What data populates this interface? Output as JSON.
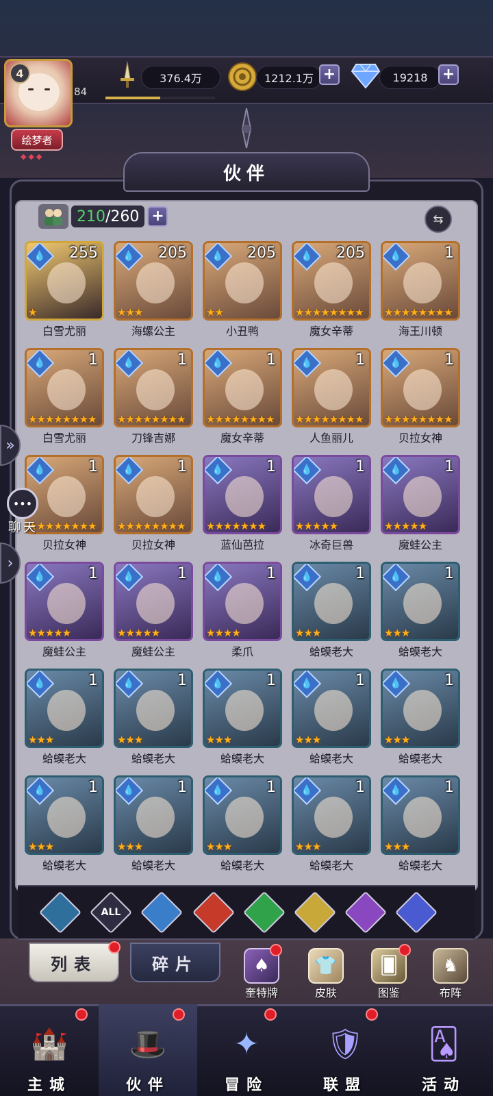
{
  "player": {
    "level": "4",
    "sub_level": "84",
    "title": "绘梦者",
    "title_dots": "◆◆◆",
    "power_progress": 0.5
  },
  "resources": {
    "power": "376.4万",
    "gold": "1212.1万",
    "gems": "19218",
    "plus": "+"
  },
  "panel": {
    "title": "伙伴",
    "count_current": "210",
    "count_max": "/260",
    "plus": "+"
  },
  "partners": [
    {
      "name": "白雪尤丽",
      "level": "255",
      "stars": "★",
      "border": "gold"
    },
    {
      "name": "海螺公主",
      "level": "205",
      "stars": "★★★",
      "border": "orange"
    },
    {
      "name": "小丑鸭",
      "level": "205",
      "stars": "★★",
      "border": "orange"
    },
    {
      "name": "魔女辛蒂",
      "level": "205",
      "stars": "★★★★★★★★",
      "border": "orange"
    },
    {
      "name": "海王川顿",
      "level": "1",
      "stars": "★★★★★★★★",
      "border": "orange"
    },
    {
      "name": "白雪尤丽",
      "level": "1",
      "stars": "★★★★★★★★",
      "border": "orange"
    },
    {
      "name": "刀锋吉娜",
      "level": "1",
      "stars": "★★★★★★★★",
      "border": "orange"
    },
    {
      "name": "魔女辛蒂",
      "level": "1",
      "stars": "★★★★★★★★",
      "border": "orange"
    },
    {
      "name": "人鱼丽儿",
      "level": "1",
      "stars": "★★★★★★★★",
      "border": "orange"
    },
    {
      "name": "贝拉女神",
      "level": "1",
      "stars": "★★★★★★★★",
      "border": "orange"
    },
    {
      "name": "贝拉女神",
      "level": "1",
      "stars": "★★★★★★★★",
      "border": "orange"
    },
    {
      "name": "贝拉女神",
      "level": "1",
      "stars": "★★★★★★★★",
      "border": "orange"
    },
    {
      "name": "蓝仙芭拉",
      "level": "1",
      "stars": "★★★★★★★",
      "border": "purple"
    },
    {
      "name": "冰奇巨兽",
      "level": "1",
      "stars": "★★★★★",
      "border": "purple"
    },
    {
      "name": "魔蛙公主",
      "level": "1",
      "stars": "★★★★★",
      "border": "purple"
    },
    {
      "name": "魔蛙公主",
      "level": "1",
      "stars": "★★★★★",
      "border": "purple"
    },
    {
      "name": "魔蛙公主",
      "level": "1",
      "stars": "★★★★★",
      "border": "purple"
    },
    {
      "name": "柔爪",
      "level": "1",
      "stars": "★★★★",
      "border": "purple"
    },
    {
      "name": "蛤蟆老大",
      "level": "1",
      "stars": "★★★",
      "border": "teal"
    },
    {
      "name": "蛤蟆老大",
      "level": "1",
      "stars": "★★★",
      "border": "teal"
    },
    {
      "name": "蛤蟆老大",
      "level": "1",
      "stars": "★★★",
      "border": "teal"
    },
    {
      "name": "蛤蟆老大",
      "level": "1",
      "stars": "★★★",
      "border": "teal"
    },
    {
      "name": "蛤蟆老大",
      "level": "1",
      "stars": "★★★",
      "border": "teal"
    },
    {
      "name": "蛤蟆老大",
      "level": "1",
      "stars": "★★★",
      "border": "teal"
    },
    {
      "name": "蛤蟆老大",
      "level": "1",
      "stars": "★★★",
      "border": "teal"
    },
    {
      "name": "蛤蟆老大",
      "level": "1",
      "stars": "★★★",
      "border": "teal"
    },
    {
      "name": "蛤蟆老大",
      "level": "1",
      "stars": "★★★",
      "border": "teal"
    },
    {
      "name": "蛤蟆老大",
      "level": "1",
      "stars": "★★★",
      "border": "teal"
    },
    {
      "name": "蛤蟆老大",
      "level": "1",
      "stars": "★★★",
      "border": "teal"
    },
    {
      "name": "蛤蟆老大",
      "level": "1",
      "stars": "★★★",
      "border": "teal"
    }
  ],
  "filters": [
    {
      "name": "filter-water-alt",
      "label": "",
      "color": "#2f6f9c"
    },
    {
      "name": "filter-all",
      "label": "ALL",
      "color": "#2e2c40"
    },
    {
      "name": "filter-water",
      "label": "",
      "color": "#3a7dc8"
    },
    {
      "name": "filter-fire",
      "label": "",
      "color": "#c63a2a"
    },
    {
      "name": "filter-wind",
      "label": "",
      "color": "#2fa24a"
    },
    {
      "name": "filter-light",
      "label": "",
      "color": "#c9a83a"
    },
    {
      "name": "filter-dark",
      "label": "",
      "color": "#8a48c0"
    },
    {
      "name": "filter-cosmic",
      "label": "",
      "color": "#4a5ad0"
    }
  ],
  "tabs": {
    "list": "列表",
    "fragments": "碎片"
  },
  "quick": {
    "tarot": "奎特牌",
    "skin": "皮肤",
    "codex": "图鉴",
    "formation": "布阵"
  },
  "nav": {
    "city": "主城",
    "partner": "伙伴",
    "adventure": "冒险",
    "alliance": "联盟",
    "event": "活动"
  },
  "chat": {
    "label": "聊天"
  },
  "colors": {
    "accent_green": "#56d26a",
    "star": "#ffb01a",
    "notify_red": "#e01e2a"
  }
}
